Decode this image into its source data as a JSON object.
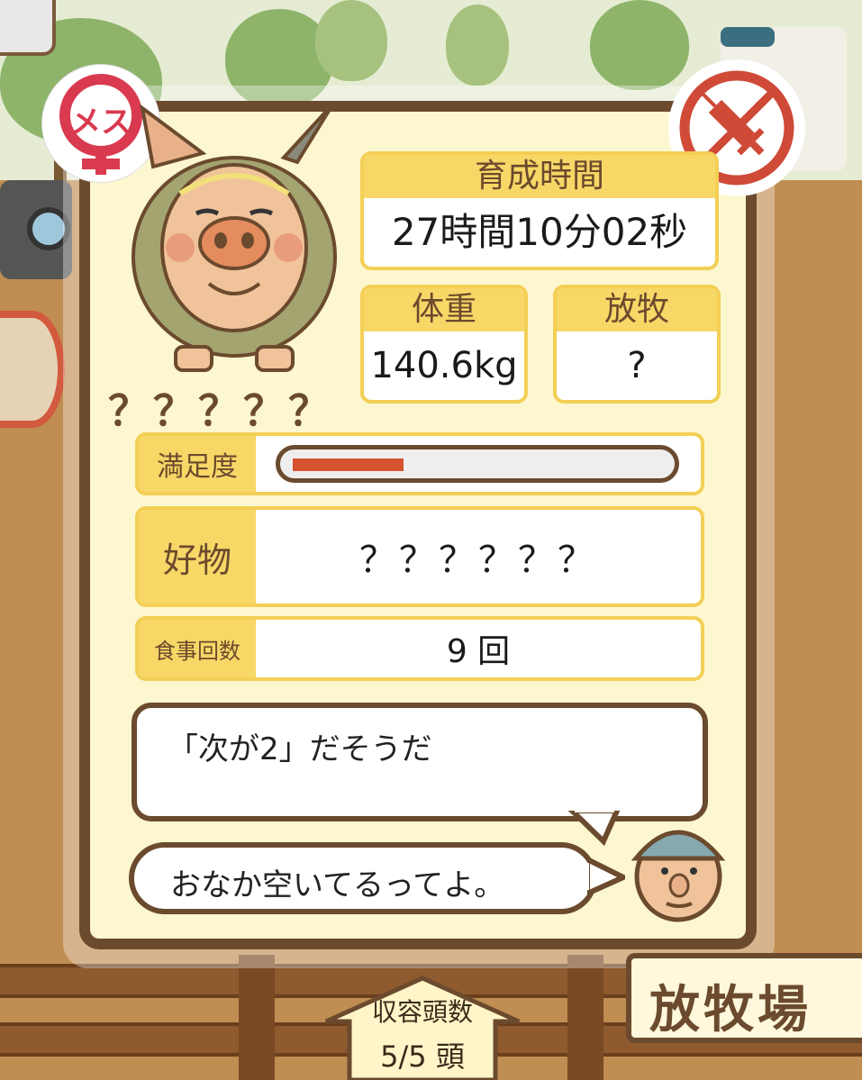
{
  "pig": {
    "name": "？？？？？",
    "gender_badge": "メス",
    "gender_icon": "female-symbol-icon",
    "vaccine_icon": "no-vaccine-syringe-icon"
  },
  "stats": {
    "growth_time": {
      "label": "育成時間",
      "value": "27時間10分02秒"
    },
    "weight": {
      "label": "体重",
      "value": "140.6kg"
    },
    "grazing": {
      "label": "放牧",
      "value": "?"
    },
    "satisfaction": {
      "label": "満足度",
      "value": 0.3
    },
    "favorite_food": {
      "label": "好物",
      "value": "？？？？？？"
    },
    "meal_count": {
      "label": "食事回数",
      "value": "9 回"
    }
  },
  "messages": {
    "hint": "「次が2」だそうだ",
    "status": "おなか空いてるってよ。"
  },
  "footer": {
    "capacity_label": "収容頭数",
    "capacity_value": "5/5 頭",
    "area_sign": "放牧場"
  },
  "colors": {
    "panel_border": "#6b4a2e",
    "label_yellow": "#f7d766",
    "satisfaction_bar": "#d5532f",
    "female_red": "#d93a4f",
    "vaccine_red": "#cf4a37"
  }
}
